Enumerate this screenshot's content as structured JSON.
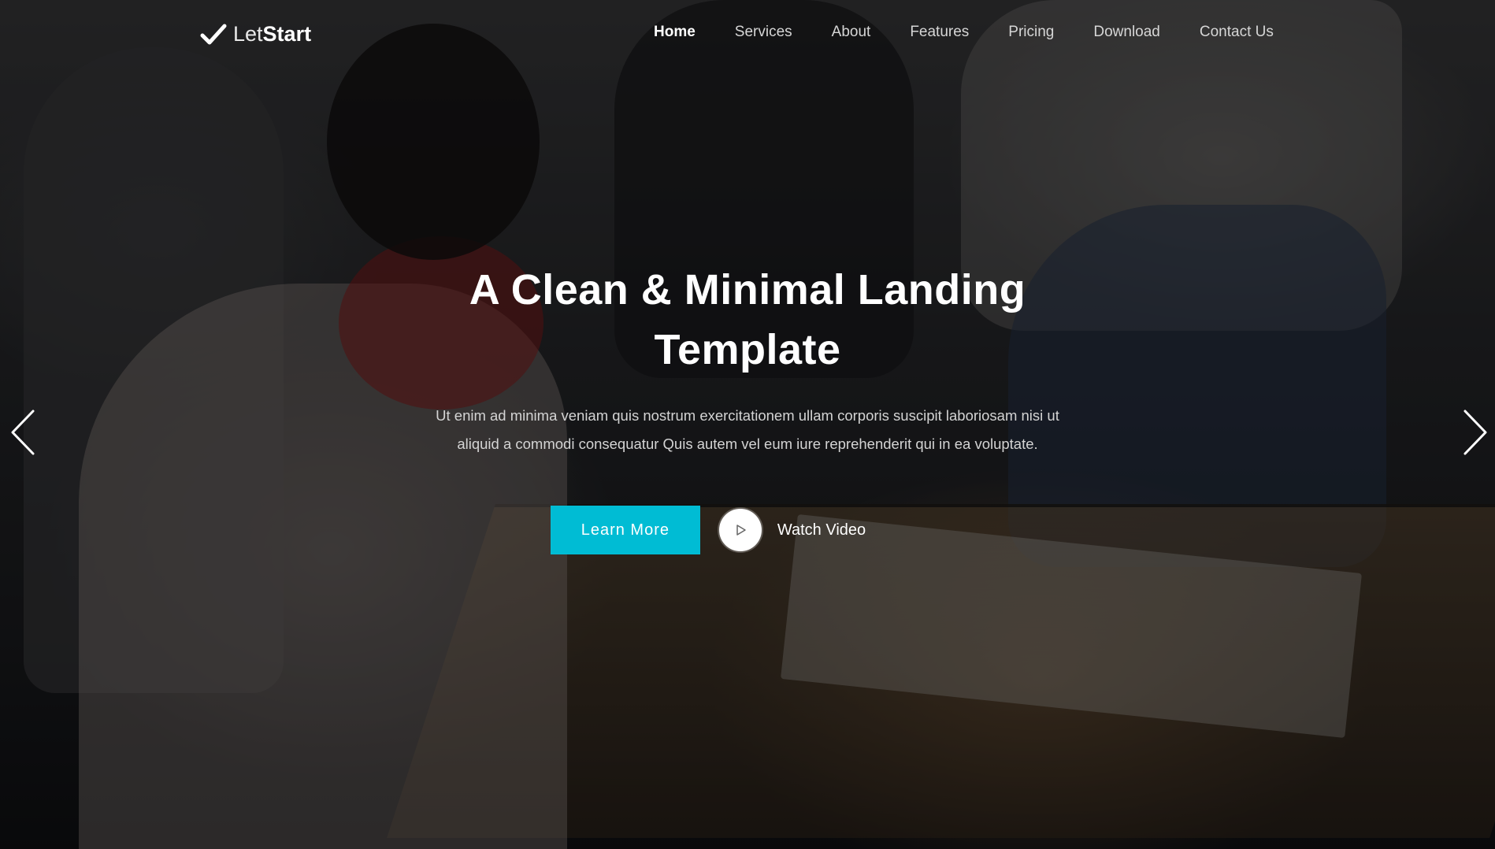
{
  "logo": {
    "light": "Let",
    "bold": "Start",
    "icon": "checkmark-icon"
  },
  "nav": {
    "items": [
      {
        "label": "Home",
        "active": true
      },
      {
        "label": "Services",
        "active": false
      },
      {
        "label": "About",
        "active": false
      },
      {
        "label": "Features",
        "active": false
      },
      {
        "label": "Pricing",
        "active": false
      },
      {
        "label": "Download",
        "active": false
      },
      {
        "label": "Contact Us",
        "active": false
      }
    ]
  },
  "hero": {
    "title_line1": "A Clean & Minimal Landing",
    "title_line2": "Template",
    "text": "Ut enim ad minima veniam quis nostrum exercitationem ullam corporis suscipit laboriosam nisi ut aliquid a commodi consequatur Quis autem vel eum iure reprehenderit qui in ea voluptate.",
    "learn_more": "Learn More",
    "watch_video": "Watch Video"
  },
  "carousel": {
    "prev_icon": "chevron-left-icon",
    "next_icon": "chevron-right-icon"
  },
  "colors": {
    "accent": "#00bcd4",
    "text": "#ffffff"
  }
}
